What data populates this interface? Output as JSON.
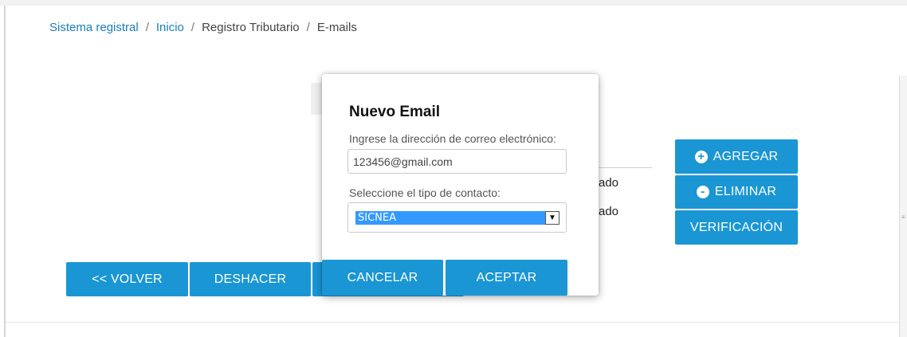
{
  "breadcrumb": {
    "items": [
      "Sistema registral",
      "Inicio",
      "Registro Tributario",
      "E-mails"
    ],
    "separator": "/"
  },
  "background": {
    "row1_text": "ado",
    "row2_text": "ado"
  },
  "side_buttons": {
    "add": "AGREGAR",
    "add_icon": "+",
    "remove": "ELIMINAR",
    "remove_icon": "-",
    "verify": "VERIFICACIÓN"
  },
  "bottom_buttons": {
    "back": "<< VOLVER",
    "undo": "DESHACER"
  },
  "modal": {
    "title": "Nuevo Email",
    "email_label": "Ingrese la dirección de correo electrónico:",
    "email_value": "123456@gmail.com",
    "type_label": "Seleccione el tipo de contacto:",
    "type_selected": "SICNEA",
    "type_arrow": "▼",
    "cancel": "CANCELAR",
    "accept": "ACEPTAR"
  },
  "colors": {
    "primary": "#1a96d4",
    "link": "#1a7fb8",
    "select_highlight": "#3399ff"
  }
}
